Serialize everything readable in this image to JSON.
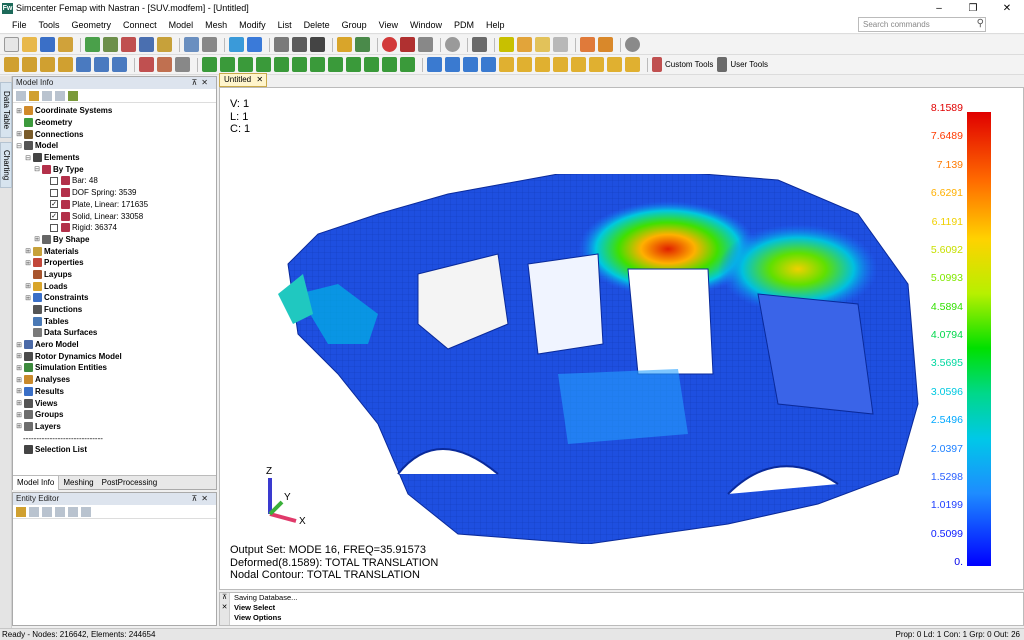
{
  "window": {
    "title": "Simcenter Femap with Nastran - [SUV.modfem] - [Untitled]",
    "app_icon": "Fw",
    "min_glyph": "–",
    "max_glyph": "❐",
    "close_glyph": "✕"
  },
  "menu": {
    "items": [
      "File",
      "Tools",
      "Geometry",
      "Connect",
      "Model",
      "Mesh",
      "Modify",
      "List",
      "Delete",
      "Group",
      "View",
      "Window",
      "PDM",
      "Help"
    ],
    "search_placeholder": "Search commands"
  },
  "toolbar": {
    "custom_tools_label": "Custom Tools",
    "user_tools_label": "User Tools"
  },
  "side_tabs": [
    "Data Table",
    "Charting"
  ],
  "model_info": {
    "title": "Model Info",
    "tree": [
      {
        "label": "Coordinate Systems",
        "bold": true,
        "indent": 0,
        "toggle": "⊞",
        "color": "#d08a2a"
      },
      {
        "label": "Geometry",
        "bold": true,
        "indent": 0,
        "toggle": "",
        "color": "#3c9a3c"
      },
      {
        "label": "Connections",
        "bold": true,
        "indent": 0,
        "toggle": "⊞",
        "color": "#7a5c2a"
      },
      {
        "label": "Model",
        "bold": true,
        "indent": 0,
        "toggle": "⊟",
        "color": "#555555"
      },
      {
        "label": "Elements",
        "bold": true,
        "indent": 1,
        "toggle": "⊟",
        "color": "#444444"
      },
      {
        "label": "By Type",
        "bold": true,
        "indent": 2,
        "toggle": "⊟",
        "color": "#b3304a"
      },
      {
        "label": "Bar: 48",
        "bold": false,
        "indent": 3,
        "check": false,
        "color": "#b3304a"
      },
      {
        "label": "DOF Spring: 3539",
        "bold": false,
        "indent": 3,
        "check": false,
        "color": "#b3304a"
      },
      {
        "label": "Plate, Linear: 171635",
        "bold": false,
        "indent": 3,
        "check": true,
        "color": "#b3304a"
      },
      {
        "label": "Solid, Linear: 33058",
        "bold": false,
        "indent": 3,
        "check": true,
        "color": "#b3304a"
      },
      {
        "label": "Rigid: 36374",
        "bold": false,
        "indent": 3,
        "check": false,
        "color": "#b3304a"
      },
      {
        "label": "By Shape",
        "bold": true,
        "indent": 2,
        "toggle": "⊞",
        "color": "#666666"
      },
      {
        "label": "Materials",
        "bold": true,
        "indent": 1,
        "toggle": "⊞",
        "color": "#c7a13a"
      },
      {
        "label": "Properties",
        "bold": true,
        "indent": 1,
        "toggle": "⊞",
        "color": "#c2473a"
      },
      {
        "label": "Layups",
        "bold": true,
        "indent": 1,
        "toggle": "",
        "color": "#a8552e"
      },
      {
        "label": "Loads",
        "bold": true,
        "indent": 1,
        "toggle": "⊞",
        "color": "#d9a52a"
      },
      {
        "label": "Constraints",
        "bold": true,
        "indent": 1,
        "toggle": "⊞",
        "color": "#3a6fc7"
      },
      {
        "label": "Functions",
        "bold": true,
        "indent": 1,
        "toggle": "",
        "color": "#555555"
      },
      {
        "label": "Tables",
        "bold": true,
        "indent": 1,
        "toggle": "",
        "color": "#4a79b5"
      },
      {
        "label": "Data Surfaces",
        "bold": true,
        "indent": 1,
        "toggle": "",
        "color": "#7a7a7a"
      },
      {
        "label": "Aero Model",
        "bold": true,
        "indent": 0,
        "toggle": "⊞",
        "color": "#4b6aa8"
      },
      {
        "label": "Rotor Dynamics Model",
        "bold": true,
        "indent": 0,
        "toggle": "⊞",
        "color": "#4b4b4b"
      },
      {
        "label": "Simulation Entities",
        "bold": true,
        "indent": 0,
        "toggle": "⊞",
        "color": "#3d8a3d"
      },
      {
        "label": "Analyses",
        "bold": true,
        "indent": 0,
        "toggle": "⊞",
        "color": "#c98a2c"
      },
      {
        "label": "Results",
        "bold": true,
        "indent": 0,
        "toggle": "⊞",
        "color": "#3a6fc7"
      },
      {
        "label": "Views",
        "bold": true,
        "indent": 0,
        "toggle": "⊞",
        "color": "#555555"
      },
      {
        "label": "Groups",
        "bold": true,
        "indent": 0,
        "toggle": "⊞",
        "color": "#6d6d6d"
      },
      {
        "label": "Layers",
        "bold": true,
        "indent": 0,
        "toggle": "⊞",
        "color": "#6d6d6d"
      },
      {
        "label": "------------------------------",
        "bold": false,
        "indent": 0,
        "toggle": "",
        "color": ""
      },
      {
        "label": "Selection List",
        "bold": true,
        "indent": 0,
        "toggle": "",
        "color": "#444444"
      }
    ],
    "tabs": [
      "Model Info",
      "Meshing",
      "PostProcessing"
    ]
  },
  "entity_editor": {
    "title": "Entity Editor"
  },
  "document_tab": "Untitled",
  "viewport": {
    "vlc": [
      "V: 1",
      "L: 1",
      "C: 1"
    ],
    "output_set": "Output Set: MODE 16, FREQ=35.91573",
    "deformed": "Deformed(8.1589): TOTAL TRANSLATION",
    "contour": "Nodal Contour: TOTAL TRANSLATION",
    "axis_labels": {
      "x": "X",
      "y": "Y",
      "z": "Z"
    }
  },
  "legend": {
    "values": [
      "8.1589",
      "7.6489",
      "7.139",
      "6.6291",
      "6.1191",
      "5.6092",
      "5.0993",
      "4.5894",
      "4.0794",
      "3.5695",
      "3.0596",
      "2.5496",
      "2.0397",
      "1.5298",
      "1.0199",
      "0.5099",
      "0."
    ],
    "colors": [
      "#e00000",
      "#ff3a00",
      "#ff7a00",
      "#ffb000",
      "#f0d000",
      "#c8e000",
      "#80e800",
      "#30e000",
      "#00d84a",
      "#00d8a0",
      "#00c8e0",
      "#00a8ff",
      "#1e80ff",
      "#2a60ff",
      "#2040ff",
      "#1020ff",
      "#0000e8"
    ]
  },
  "messages": [
    "Saving Database...",
    "View Select",
    "View Options"
  ],
  "status": {
    "left": "Ready - Nodes: 216642, Elements: 244654",
    "right": "Prop: 0  Ld: 1  Con: 1  Grp: 0  Out: 26"
  }
}
